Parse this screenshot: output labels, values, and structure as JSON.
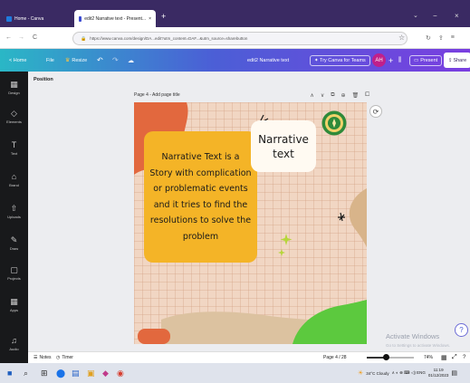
{
  "browser": {
    "tabs": [
      {
        "label": "Home - Canva"
      },
      {
        "label": "edit2 Narrative text - Present...",
        "close": "×"
      }
    ],
    "new_tab": "+",
    "window_controls": {
      "chevron": "⌄",
      "minimize": "−",
      "close": "×"
    },
    "nav": {
      "back": "←",
      "forward": "→",
      "reload": "C"
    },
    "url": "https://www.canva.com/design/DA...edit?utm_content=DAF...&utm_source=sharebutton",
    "star": "☆",
    "toolbar_icons": [
      "↻",
      "⇪",
      "≡"
    ]
  },
  "toolbar": {
    "home": "< Home",
    "file": "File",
    "resize": "Resize",
    "undo": "↶",
    "redo": "↷",
    "cloud": "☁",
    "doc_title": "edit2 Narrative text",
    "try_canva": "✦ Try Canva for Teams",
    "avatar": "AH",
    "add": "+",
    "chart_icon": "⫼",
    "present": "Present",
    "share": "Share"
  },
  "sidebar": {
    "items": [
      {
        "icon": "▦",
        "label": "Design"
      },
      {
        "icon": "◇",
        "label": "Elements"
      },
      {
        "icon": "T",
        "label": "Text"
      },
      {
        "icon": "⌂",
        "label": "Brand"
      },
      {
        "icon": "⇧",
        "label": "Uploads"
      },
      {
        "icon": "✎",
        "label": "Draw"
      },
      {
        "icon": "▢",
        "label": "Projects"
      },
      {
        "icon": "▦",
        "label": "Apps"
      },
      {
        "icon": "♫",
        "label": "Audio"
      }
    ]
  },
  "editor": {
    "position_label": "Position",
    "page_label": "Page 4 - Add page title",
    "page_controls": [
      "∧",
      "∨",
      "⧉",
      "⊕",
      "🗑",
      "⧠"
    ],
    "rotate_icon": "⟳"
  },
  "slide": {
    "title": "Narrative\ntext",
    "body": "Narrative Text is a Story with complication or problematic events and it tries to find the resolutions to solve the problem"
  },
  "watermark": {
    "title": "Activate Windows",
    "subtitle": "Go to Settings to activate Windows."
  },
  "help_icon": "?",
  "footer": {
    "notes": "Notes",
    "timer": "Timer",
    "page_counter": "Page 4 / 28",
    "zoom": "74%",
    "zoom_level": 0.4,
    "grid_icon": "▦",
    "fullscreen_icon": "⤢",
    "help_icon": "?"
  },
  "taskbar": {
    "start": "■",
    "search": "⌕",
    "apps": [
      "⊞",
      "⬤",
      "▤",
      "▣",
      "◆",
      "◉"
    ],
    "tray": {
      "weather": "34°C Cloudy",
      "icons": "∧ ◐ ⊕ ⌨ ◁) ENG",
      "time": "11:19",
      "date": "01/12/2023"
    }
  },
  "colors": {
    "canva_gradient_start": "#2ab7c6",
    "canva_gradient_end": "#7a3ee0",
    "slide_background": "#f1d6c3",
    "card_yellow": "#f4b427",
    "title_card": "#fffaf2",
    "accent_green": "#5cc93e",
    "accent_orange": "#e2683e",
    "accent_tan": "#d8b48a"
  }
}
